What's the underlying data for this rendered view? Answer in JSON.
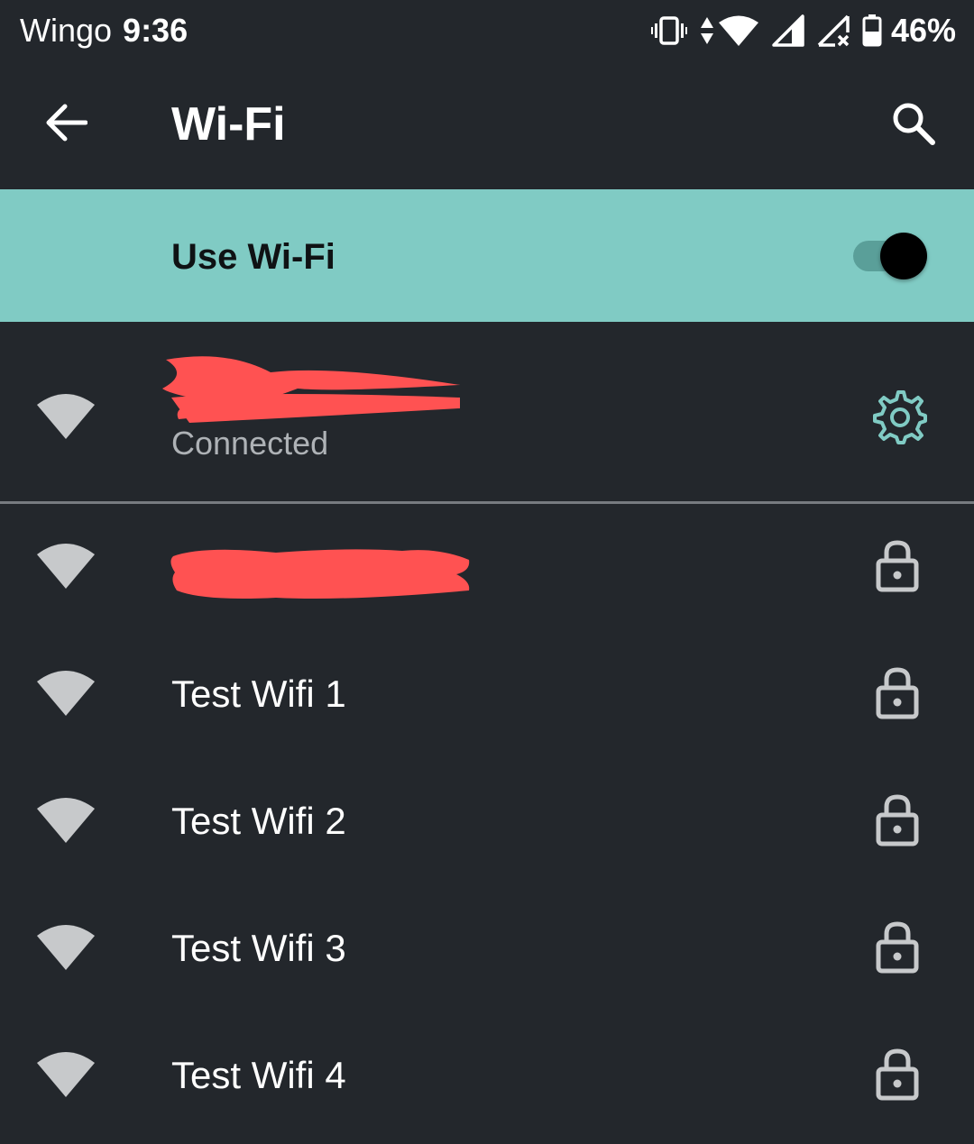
{
  "status_bar": {
    "carrier": "Wingo",
    "time": "9:36",
    "battery_percent": "46%",
    "icons": [
      "vibrate-icon",
      "data-arrows-icon",
      "wifi-signal-icon",
      "cell-signal-icon",
      "cell-signal-no-service-icon",
      "battery-icon"
    ]
  },
  "app_bar": {
    "title": "Wi-Fi",
    "back_icon": "arrow-back-icon",
    "search_icon": "search-icon"
  },
  "master_switch": {
    "label": "Use Wi-Fi",
    "enabled": true,
    "background_color": "#80cbc4"
  },
  "connected_network": {
    "status": "Connected",
    "signal_icon": "wifi-icon",
    "settings_icon": "gear-icon",
    "accent_color": "#80cbc4"
  },
  "networks": [
    {
      "name": "",
      "secured": true
    },
    {
      "name": "Test Wifi 1",
      "secured": true
    },
    {
      "name": "Test Wifi 2",
      "secured": true
    },
    {
      "name": "Test Wifi 3",
      "secured": true
    },
    {
      "name": "Test Wifi 4",
      "secured": true
    }
  ],
  "colors": {
    "background": "#23272c",
    "redaction": "#ff5252",
    "icon_gray": "#c7c9cb"
  }
}
